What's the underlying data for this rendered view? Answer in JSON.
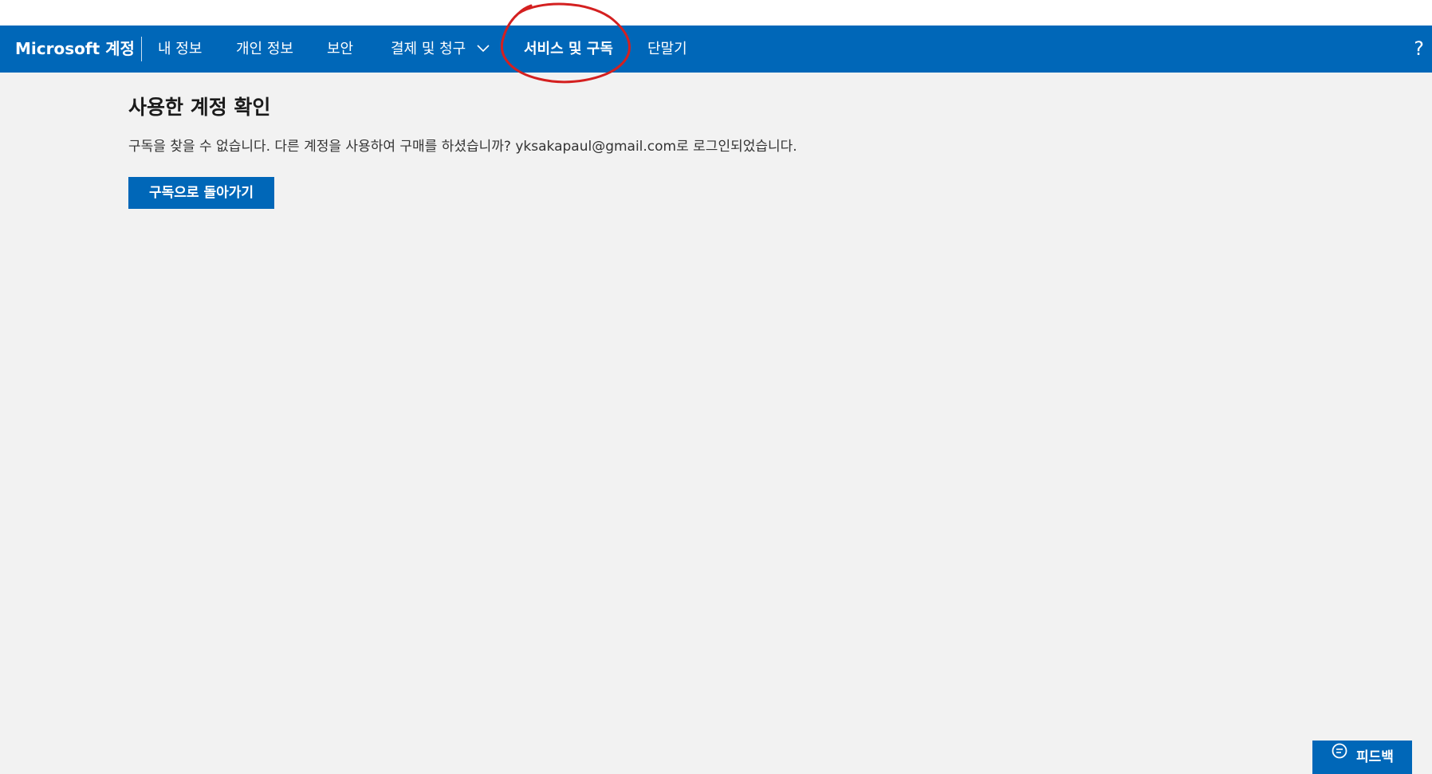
{
  "header": {
    "brand": "Microsoft 계정",
    "nav": [
      {
        "label": "내 정보"
      },
      {
        "label": "개인 정보"
      },
      {
        "label": "보안"
      },
      {
        "label": "결제 및 청구"
      },
      {
        "label": "서비스 및 구독",
        "active": true
      },
      {
        "label": "단말기"
      }
    ],
    "help": "?"
  },
  "main": {
    "title": "사용한 계정 확인",
    "message": "구독을 찾을 수 없습니다. 다른 계정을 사용하여 구매를 하셨습니까? yksakapaul@gmail.com로 로그인되었습니다.",
    "back_button": "구독으로 돌아가기"
  },
  "feedback": {
    "label": "피드백"
  },
  "colors": {
    "brand_blue": "#0067b8",
    "background": "#f2f2f2",
    "annotation_red": "#d42020"
  },
  "icons": [
    "chevron-down-icon",
    "help-icon",
    "feedback-icon"
  ]
}
